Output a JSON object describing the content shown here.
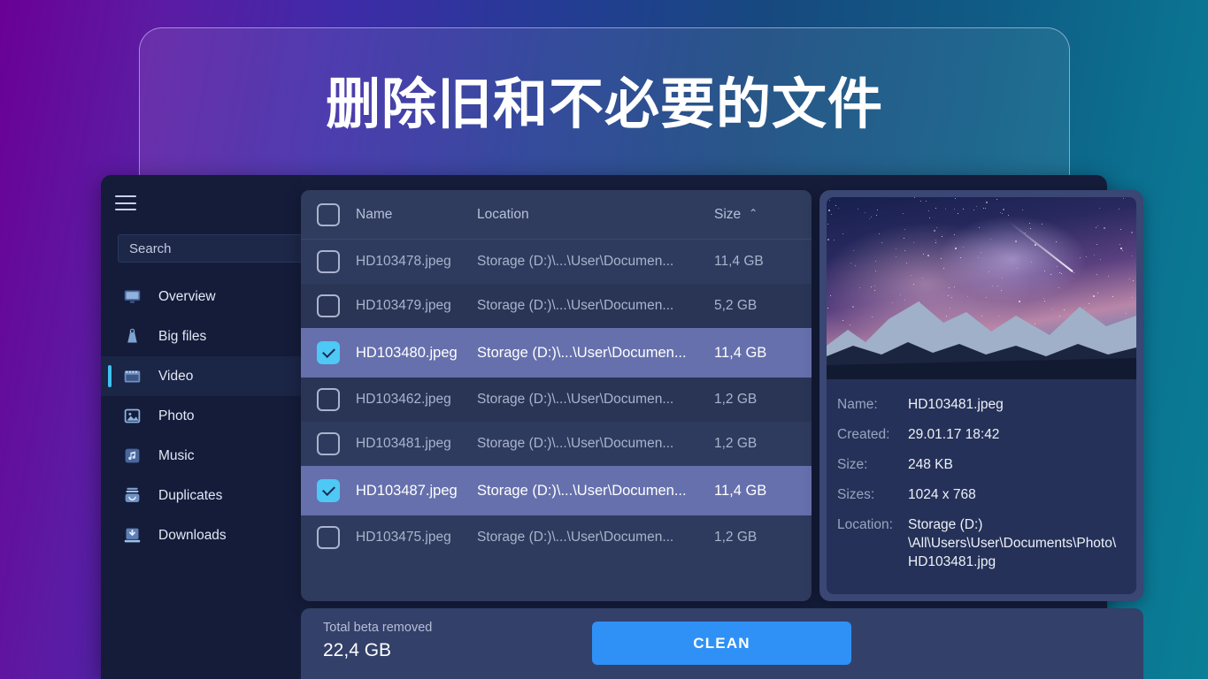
{
  "hero": {
    "title": "删除旧和不必要的文件"
  },
  "sidebar": {
    "menu_icon": "hamburger-icon",
    "search": {
      "placeholder": "Search",
      "value": ""
    },
    "items": [
      {
        "label": "Overview",
        "icon": "monitor-icon",
        "active": false
      },
      {
        "label": "Big files",
        "icon": "weight-icon",
        "active": false
      },
      {
        "label": "Video",
        "icon": "film-icon",
        "active": true
      },
      {
        "label": "Photo",
        "icon": "image-icon",
        "active": false
      },
      {
        "label": "Music",
        "icon": "music-note-icon",
        "active": false
      },
      {
        "label": "Duplicates",
        "icon": "duplicate-icon",
        "active": false
      },
      {
        "label": "Downloads",
        "icon": "download-icon",
        "active": false
      }
    ]
  },
  "file_list": {
    "columns": {
      "name": "Name",
      "location": "Location",
      "size": "Size",
      "sort_caret": "⌃"
    },
    "header_checkbox_checked": false,
    "rows": [
      {
        "name": "HD103478.jpeg",
        "location": "Storage (D:)\\...\\User\\Documen...",
        "size": "11,4 GB",
        "checked": false,
        "selected": false
      },
      {
        "name": "HD103479.jpeg",
        "location": "Storage (D:)\\...\\User\\Documen...",
        "size": "5,2 GB",
        "checked": false,
        "selected": false
      },
      {
        "name": "HD103480.jpeg",
        "location": "Storage (D:)\\...\\User\\Documen...",
        "size": "11,4 GB",
        "checked": true,
        "selected": true
      },
      {
        "name": "HD103462.jpeg",
        "location": "Storage (D:)\\...\\User\\Documen...",
        "size": "1,2 GB",
        "checked": false,
        "selected": false
      },
      {
        "name": "HD103481.jpeg",
        "location": "Storage (D:)\\...\\User\\Documen...",
        "size": "1,2 GB",
        "checked": false,
        "selected": false
      },
      {
        "name": "HD103487.jpeg",
        "location": "Storage (D:)\\...\\User\\Documen...",
        "size": "11,4 GB",
        "checked": true,
        "selected": true
      },
      {
        "name": "HD103475.jpeg",
        "location": "Storage (D:)\\...\\User\\Documen...",
        "size": "1,2 GB",
        "checked": false,
        "selected": false
      }
    ]
  },
  "details": {
    "preview_alt": "milky-way-over-mountains-photo",
    "fields": [
      {
        "key": "Name:",
        "value": "HD103481.jpeg"
      },
      {
        "key": "Created:",
        "value": "29.01.17  18:42"
      },
      {
        "key": "Size:",
        "value": "248 KB"
      },
      {
        "key": "Sizes:",
        "value": "1024 x 768"
      }
    ],
    "location": {
      "key": "Location:",
      "line1": "Storage (D:)",
      "line2": "\\All\\Users\\User\\Documents\\Photo\\",
      "line3": "HD103481.jpg"
    }
  },
  "footer": {
    "total_label": "Total beta removed",
    "total_value": "22,4 GB",
    "clean_button": "CLEAN"
  },
  "colors": {
    "accent_blue": "#2f91f5",
    "checkbox_checked": "#4ec8f5",
    "active_indicator": "#3fc3f0",
    "selected_row": "#6670ad",
    "sidebar_bg": "#141c3a",
    "panel_bg": "#2f3b5e"
  }
}
